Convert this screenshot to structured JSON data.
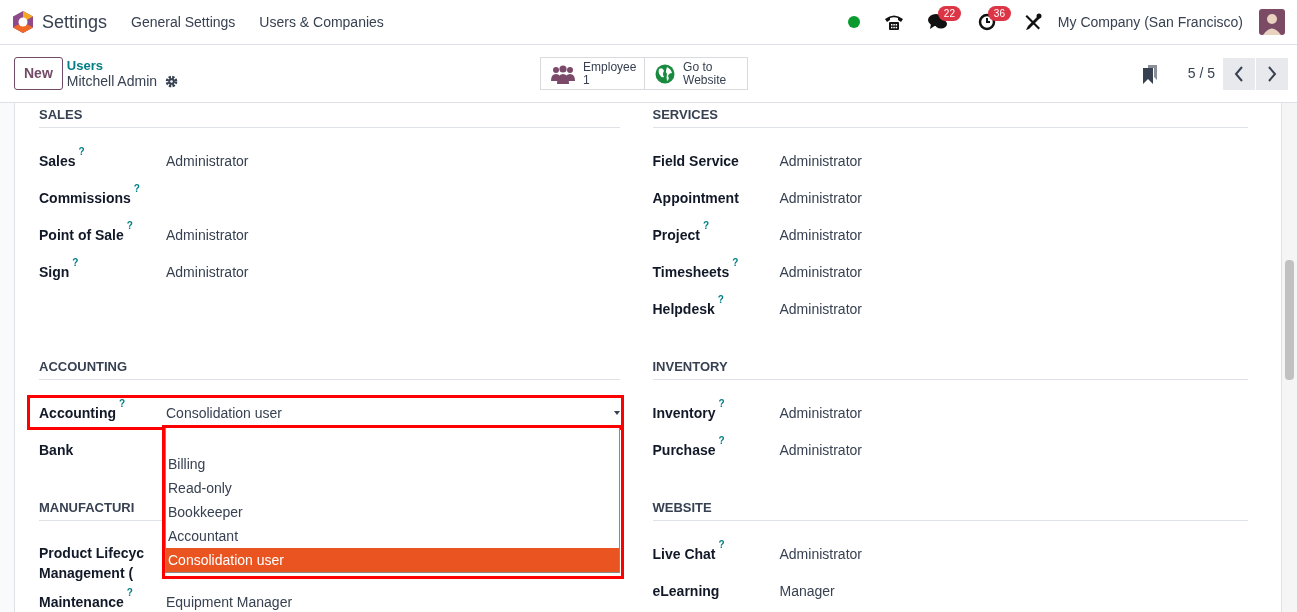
{
  "navbar": {
    "app_title": "Settings",
    "menu": [
      "General Settings",
      "Users & Companies"
    ],
    "online": true,
    "messages_badge": "22",
    "activities_badge": "36",
    "company": "My Company (San Francisco)"
  },
  "control_panel": {
    "new_button": "New",
    "breadcrumb": "Users",
    "record_title": "Mitchell Admin",
    "stat_buttons": [
      {
        "kind": "employees",
        "label": "Employee",
        "value": "1"
      },
      {
        "kind": "website",
        "label": "Go to Website"
      }
    ],
    "pager": "5 / 5"
  },
  "section_rows": [
    [
      {
        "title": "SALES",
        "fields": [
          {
            "label": "Sales",
            "help": "?",
            "value": "Administrator"
          },
          {
            "label": "Commissions",
            "help": "?"
          },
          {
            "label": "Point of Sale",
            "help": "?",
            "value": "Administrator"
          },
          {
            "label": "Sign",
            "help": "?",
            "value": "Administrator"
          }
        ]
      },
      {
        "title": "SERVICES",
        "fields": [
          {
            "label": "Field Service",
            "value": "Administrator"
          },
          {
            "label": "Appointment",
            "value": "Administrator"
          },
          {
            "label": "Project",
            "help": "?",
            "value": "Administrator"
          },
          {
            "label": "Timesheets",
            "help": "?",
            "value": "Administrator"
          },
          {
            "label": "Helpdesk",
            "help": "?",
            "value": "Administrator"
          }
        ]
      }
    ],
    [
      {
        "title": "ACCOUNTING",
        "fields": [
          {
            "label": "Accounting",
            "help": "?",
            "kind": "select",
            "value": "Consolidation user",
            "highlighted": true,
            "expanded": true,
            "blank_option": true,
            "list_highlighted": true,
            "options": [
              {
                "label": "Billing",
                "selected": false
              },
              {
                "label": "Read-only",
                "selected": false
              },
              {
                "label": "Bookkeeper",
                "selected": false
              },
              {
                "label": "Accountant",
                "selected": false
              },
              {
                "label": "Consolidation user",
                "selected": true
              }
            ]
          },
          {
            "label": "Bank"
          }
        ]
      },
      {
        "title": "INVENTORY",
        "fields": [
          {
            "label": "Inventory",
            "help": "?",
            "value": "Administrator"
          },
          {
            "label": "Purchase",
            "help": "?",
            "value": "Administrator"
          }
        ]
      }
    ],
    [
      {
        "title": "MANUFACTURI",
        "fields": [
          {
            "label": "Product Lifecyc",
            "label_continued": "Management ("
          },
          {
            "label": "Maintenance",
            "help": "?",
            "value": "Equipment Manager"
          }
        ]
      },
      {
        "title": "WEBSITE",
        "fields": [
          {
            "label": "Live Chat",
            "help": "?",
            "value": "Administrator"
          },
          {
            "label": "eLearning",
            "value": "Manager"
          }
        ]
      }
    ]
  ]
}
